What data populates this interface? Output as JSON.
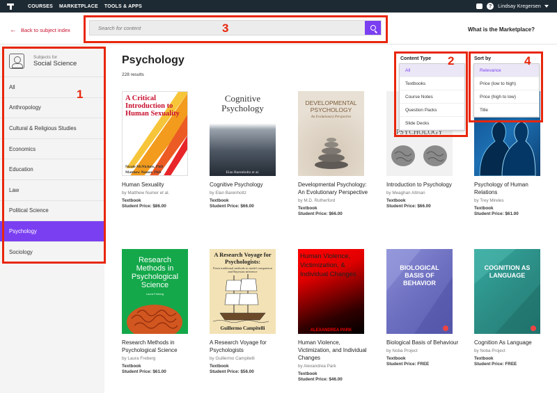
{
  "topbar": {
    "nav": [
      "COURSES",
      "MARKETPLACE",
      "TOOLS & APPS"
    ],
    "user": "Lindsay Kregersen"
  },
  "header": {
    "back": "Back to subject index",
    "search_placeholder": "Search for content",
    "marketplace_link": "What is the Marketplace?"
  },
  "annotations": [
    "1",
    "2",
    "3",
    "4"
  ],
  "sidebar": {
    "subject_prefix": "Subjects for",
    "subject": "Social Science",
    "items": [
      "All",
      "Anthropology",
      "Cultural & Religious Studies",
      "Economics",
      "Education",
      "Law",
      "Political Science",
      "Psychology",
      "Sociology"
    ],
    "active": "Psychology"
  },
  "main": {
    "title": "Psychology",
    "results": "228 results"
  },
  "content_type": {
    "label": "Content Type",
    "options": [
      "All",
      "Textbooks",
      "Course Notes",
      "Question Packs",
      "Slide Decks"
    ],
    "selected": "All"
  },
  "sort_by": {
    "label": "Sort by",
    "options": [
      "Relevance",
      "Price (low to high)",
      "Price (high to low)",
      "Title"
    ],
    "selected": "Relevance"
  },
  "books": [
    {
      "title": "Human Sexuality",
      "author": "by Matthew Numer et al.",
      "type": "Textbook",
      "price": "Student Price: $86.00",
      "cover_text": [
        "A Critical Introduction to Human Sexuality",
        "Nicole McNichols, PhD",
        "Matthew Numer, PhD"
      ]
    },
    {
      "title": "Cognitive Psychology",
      "author": "by Elan Barenholtz",
      "type": "Textbook",
      "price": "Student Price: $66.00",
      "cover_text": [
        "Cognitive Psychology",
        "Elan Barenholtz et al."
      ]
    },
    {
      "title": "Developmental Psychology: An Evolutionary Perspective",
      "author": "by M.D. Rutherford",
      "type": "Textbook",
      "price": "Student Price: $66.00",
      "cover_text": [
        "DEVELOPMENTAL PSYCHOLOGY",
        "An Evolutionary Perspective"
      ]
    },
    {
      "title": "Introduction to Psychology",
      "author": "by Meaghan Altman",
      "type": "Textbook",
      "price": "Student Price: $66.00",
      "cover_text": [
        "PSYCHOLOGY"
      ]
    },
    {
      "title": "Psychology of Human Relations",
      "author": "by Trey Mireles",
      "type": "Textbook",
      "price": "Student Price: $61.00",
      "cover_text": []
    },
    {
      "title": "Research Methods in Psychological Science",
      "author": "by Laura Freberg",
      "type": "Textbook",
      "price": "Student Price: $61.00",
      "cover_text": [
        "Research Methods in Psychological Science",
        "Laura Freberg"
      ]
    },
    {
      "title": "A Research Voyage for Psychologists",
      "author": "by Guillermo Campitelli",
      "type": "Textbook",
      "price": "Student Price: $56.00",
      "cover_text": [
        "A Research Voyage for Psychologists:",
        "From traditional methods to model comparison and Bayesian inference",
        "Guillermo Campitelli"
      ]
    },
    {
      "title": "Human Violence, Victimization, and Individual Changes",
      "author": "by Alexandrea Park",
      "type": "Textbook",
      "price": "Student Price: $46.00",
      "cover_text": [
        "Human Violence, Victimization, & Individual Changes",
        "ALEXANDREA PARK"
      ]
    },
    {
      "title": "Biological Basis of Behaviour",
      "author": "by Noba Project",
      "type": "Textbook",
      "price": "Student Price: FREE",
      "cover_text": [
        "BIOLOGICAL BASIS OF BEHAVIOR"
      ]
    },
    {
      "title": "Cognition As Language",
      "author": "by Noba Project",
      "type": "Textbook",
      "price": "Student Price: FREE",
      "cover_text": [
        "COGNITION AS LANGUAGE"
      ]
    }
  ],
  "colors": {
    "accent": "#7b3ff2",
    "topbar": "#1e2a33",
    "annotation": "#e8260c",
    "back_link": "#c8102e"
  }
}
